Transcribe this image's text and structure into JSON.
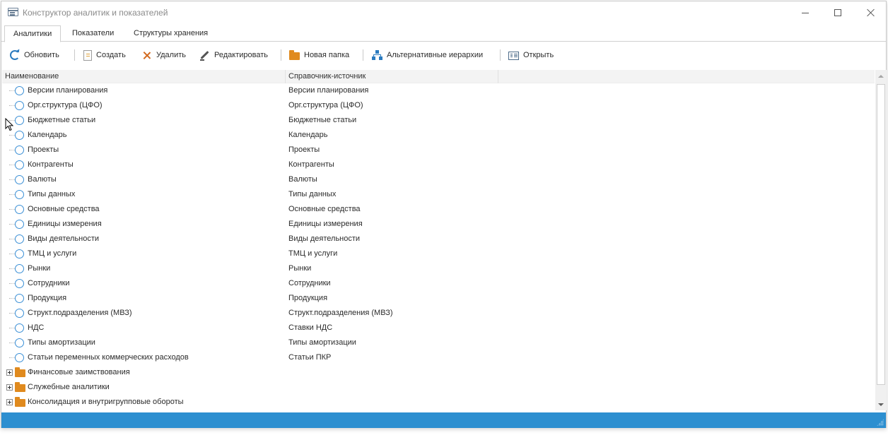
{
  "window": {
    "title": "Конструктор аналитик и показателей"
  },
  "tabs": [
    {
      "label": "Аналитики",
      "active": true
    },
    {
      "label": "Показатели",
      "active": false
    },
    {
      "label": "Структуры хранения",
      "active": false
    }
  ],
  "toolbar": {
    "refresh": "Обновить",
    "create": "Создать",
    "delete": "Удалить",
    "edit": "Редактировать",
    "new_folder": "Новая папка",
    "alt_hierarchies": "Альтернативные иерархии",
    "open": "Открыть"
  },
  "grid": {
    "columns": [
      "Наименование",
      "Справочник-источник",
      ""
    ],
    "rows": [
      {
        "name": "Версии планирования",
        "source": "Версии планирования",
        "kind": "item"
      },
      {
        "name": "Орг.структура (ЦФО)",
        "source": "Орг.структура (ЦФО)",
        "kind": "item"
      },
      {
        "name": "Бюджетные статьи",
        "source": "Бюджетные статьи",
        "kind": "item"
      },
      {
        "name": "Календарь",
        "source": "Календарь",
        "kind": "item"
      },
      {
        "name": "Проекты",
        "source": "Проекты",
        "kind": "item"
      },
      {
        "name": "Контрагенты",
        "source": "Контрагенты",
        "kind": "item"
      },
      {
        "name": "Валюты",
        "source": "Валюты",
        "kind": "item"
      },
      {
        "name": "Типы данных",
        "source": "Типы данных",
        "kind": "item"
      },
      {
        "name": "Основные средства",
        "source": "Основные средства",
        "kind": "item"
      },
      {
        "name": "Единицы измерения",
        "source": "Единицы измерения",
        "kind": "item"
      },
      {
        "name": "Виды деятельности",
        "source": "Виды деятельности",
        "kind": "item"
      },
      {
        "name": "ТМЦ и услуги",
        "source": "ТМЦ и услуги",
        "kind": "item"
      },
      {
        "name": "Рынки",
        "source": "Рынки",
        "kind": "item"
      },
      {
        "name": "Сотрудники",
        "source": "Сотрудники",
        "kind": "item"
      },
      {
        "name": "Продукция",
        "source": "Продукция",
        "kind": "item"
      },
      {
        "name": "Структ.подразделения (МВЗ)",
        "source": "Структ.подразделения (МВЗ)",
        "kind": "item"
      },
      {
        "name": "НДС",
        "source": "Ставки НДС",
        "kind": "item"
      },
      {
        "name": "Типы амортизации",
        "source": "Типы амортизации",
        "kind": "item"
      },
      {
        "name": "Статьи переменных коммерческих расходов",
        "source": "Статьи ПКР",
        "kind": "item"
      },
      {
        "name": "Финансовые заимствования",
        "source": "",
        "kind": "folder"
      },
      {
        "name": "Служебные аналитики",
        "source": "",
        "kind": "folder"
      },
      {
        "name": "Консолидация и внутригрупповые обороты",
        "source": "",
        "kind": "folder"
      }
    ]
  },
  "colors": {
    "accent": "#2d8fd0",
    "folder": "#e08a1e",
    "item_icon": "#3a8fd6",
    "delete": "#d2691e"
  }
}
